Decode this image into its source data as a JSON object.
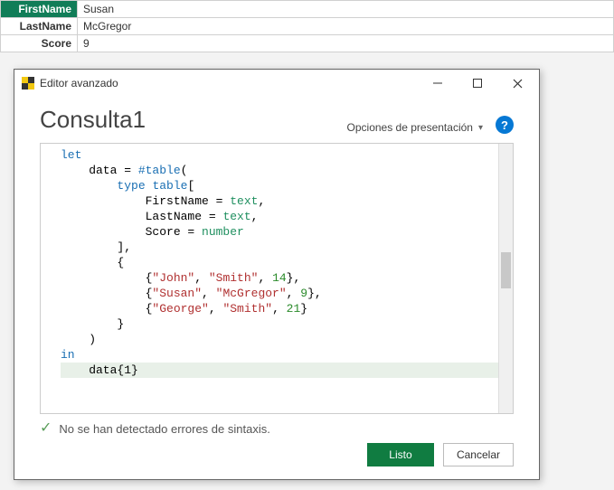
{
  "table": {
    "rows": [
      {
        "label": "FirstName",
        "value": "Susan",
        "isHeader": true
      },
      {
        "label": "LastName",
        "value": "McGregor",
        "isHeader": false
      },
      {
        "label": "Score",
        "value": "9",
        "isHeader": false
      }
    ]
  },
  "dialog": {
    "title": "Editor avanzado",
    "heading": "Consulta1",
    "presentation_label": "Opciones de presentación",
    "help_char": "?",
    "status": "No se han detectado errores de sintaxis.",
    "buttons": {
      "ok": "Listo",
      "cancel": "Cancelar"
    }
  },
  "code": {
    "l01_kw": "let",
    "l02a": "    data = ",
    "l02b": "#table",
    "l02c": "(",
    "l03a": "        ",
    "l03b": "type",
    "l03c": " ",
    "l03d": "table",
    "l03e": "[",
    "l04a": "            FirstName = ",
    "l04b": "text",
    "l04c": ",",
    "l05a": "            LastName = ",
    "l05b": "text",
    "l05c": ",",
    "l06a": "            Score = ",
    "l06b": "number",
    "l07": "        ],",
    "l08": "        {",
    "l09a": "            {",
    "l09b": "\"John\"",
    "l09c": ", ",
    "l09d": "\"Smith\"",
    "l09e": ", ",
    "l09f": "14",
    "l09g": "},",
    "l10a": "            {",
    "l10b": "\"Susan\"",
    "l10c": ", ",
    "l10d": "\"McGregor\"",
    "l10e": ", ",
    "l10f": "9",
    "l10g": "},",
    "l11a": "            {",
    "l11b": "\"George\"",
    "l11c": ", ",
    "l11d": "\"Smith\"",
    "l11e": ", ",
    "l11f": "21",
    "l11g": "}",
    "l12": "        }",
    "l13": "    )",
    "l14_kw": "in",
    "l15": "    data{1}"
  }
}
